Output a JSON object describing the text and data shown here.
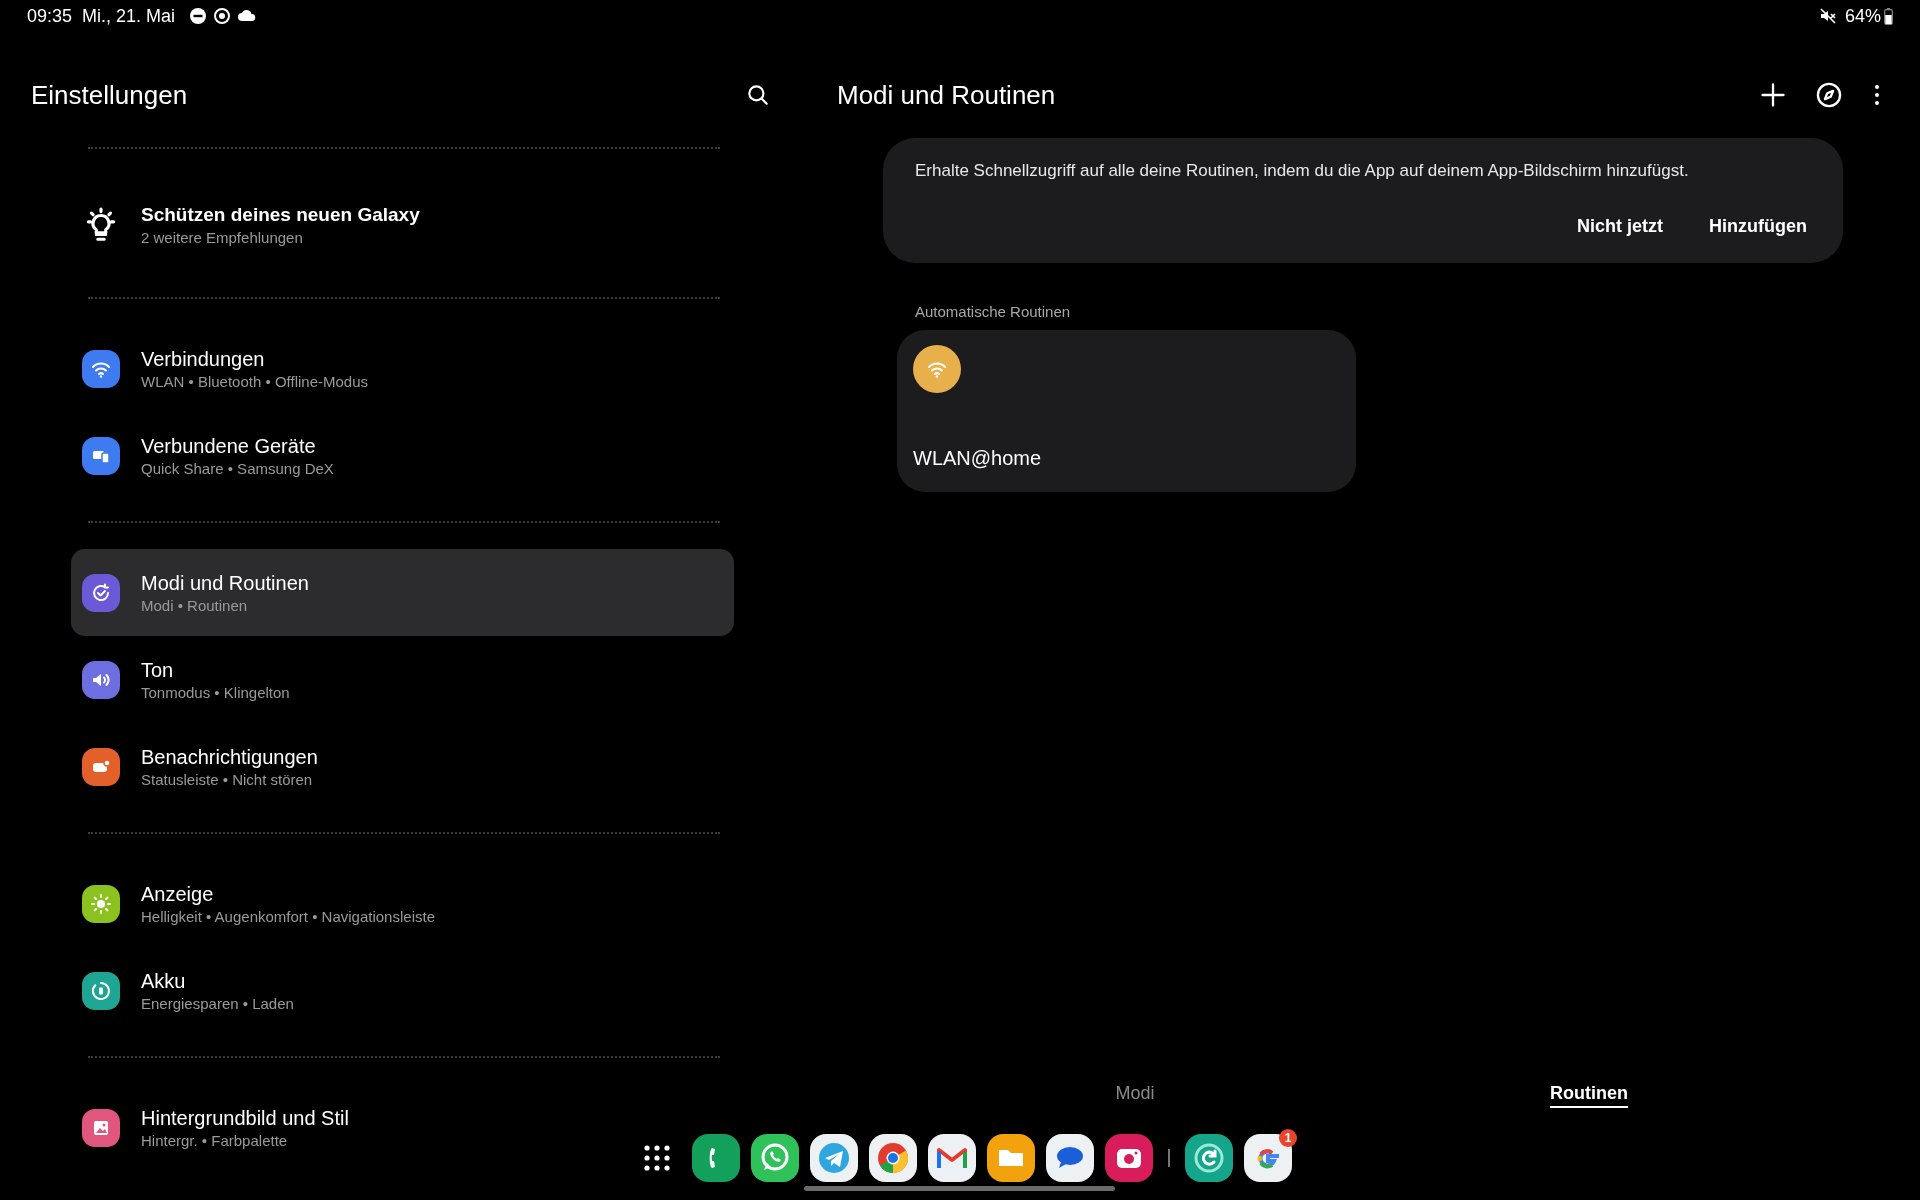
{
  "status_bar": {
    "time": "09:35",
    "date": "Mi., 21. Mai",
    "battery": "64%"
  },
  "settings": {
    "title": "Einstellungen",
    "groups": [
      [
        {
          "title": "Schützen deines neuen Galaxy",
          "subtitle": "2 weitere Empfehlungen",
          "kind": "bulb",
          "selected": false
        }
      ],
      [
        {
          "title": "Verbindungen",
          "subtitle": "WLAN • Bluetooth • Offline-Modus",
          "kind": "wifi",
          "color": "#3e7bf0",
          "selected": false
        },
        {
          "title": "Verbundene Geräte",
          "subtitle": "Quick Share • Samsung DeX",
          "kind": "devices",
          "color": "#3e7bf0",
          "selected": false
        }
      ],
      [
        {
          "title": "Modi und Routinen",
          "subtitle": "Modi • Routinen",
          "kind": "routine",
          "color": "#6a5ad8",
          "selected": true
        },
        {
          "title": "Ton",
          "subtitle": "Tonmodus • Klingelton",
          "kind": "sound",
          "color": "#6d6fe0",
          "selected": false
        },
        {
          "title": "Benachrichtigungen",
          "subtitle": "Statusleiste • Nicht stören",
          "kind": "notification",
          "color": "#e4602a",
          "selected": false
        }
      ],
      [
        {
          "title": "Anzeige",
          "subtitle": "Helligkeit • Augenkomfort • Navigationsleiste",
          "kind": "display",
          "color": "#8cc21f",
          "selected": false
        },
        {
          "title": "Akku",
          "subtitle": "Energiesparen • Laden",
          "kind": "battery",
          "color": "#1fa594",
          "selected": false
        }
      ],
      [
        {
          "title": "Hintergrundbild und Stil",
          "subtitle": "Hintergr. • Farbpalette",
          "kind": "wallpaper",
          "color": "#e0567e",
          "selected": false
        }
      ]
    ]
  },
  "detail": {
    "title": "Modi und Routinen",
    "banner": {
      "text": "Erhalte Schnellzugriff auf alle deine Routinen, indem du die App auf deinem App-Bildschirm hinzufügst.",
      "buttons": [
        "Nicht jetzt",
        "Hinzufügen"
      ]
    },
    "section": "Automatische Routinen",
    "routines": [
      {
        "name": "WLAN@home",
        "kind": "wifi",
        "color": "#e8b04a"
      }
    ],
    "tabs": [
      {
        "label": "Modi",
        "selected": false
      },
      {
        "label": "Routinen",
        "selected": true
      }
    ]
  },
  "dock": [
    {
      "kind": "apps"
    },
    {
      "kind": "phone"
    },
    {
      "kind": "whatsapp"
    },
    {
      "kind": "telegram"
    },
    {
      "kind": "chrome"
    },
    {
      "kind": "gmail"
    },
    {
      "kind": "files"
    },
    {
      "kind": "messages"
    },
    {
      "kind": "camera"
    },
    {
      "kind": "separator"
    },
    {
      "kind": "routines"
    },
    {
      "kind": "google",
      "badge": "1"
    }
  ]
}
